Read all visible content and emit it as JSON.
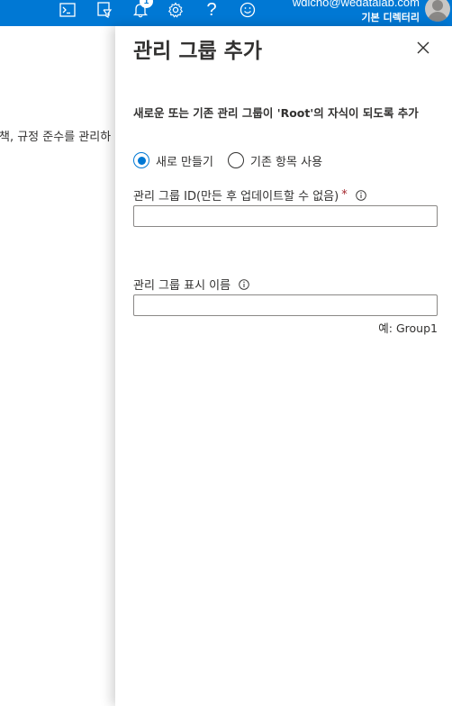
{
  "topbar": {
    "icons": [
      "cloud-shell-icon",
      "directory-filter-icon",
      "notifications-icon",
      "settings-icon",
      "help-icon",
      "feedback-icon"
    ],
    "help_glyph": "?",
    "notification_count": "1",
    "user_email": "wdlcho@wedatalab.com",
    "user_directory": "기본 디렉터리",
    "accent_color": "#0078d4"
  },
  "background": {
    "text": "책, 규정 준수를 관리하"
  },
  "panel": {
    "title": "관리 그룹 추가",
    "subtitle": "새로운 또는 기존 관리 그룹이 'Root'의 자식이 되도록 추가",
    "radio_options": [
      {
        "label": "새로 만들기",
        "checked": true
      },
      {
        "label": "기존 항목 사용",
        "checked": false
      }
    ],
    "id_field": {
      "label": "관리 그룹 ID(만든 후 업데이트할 수 없음)",
      "required_marker": "*",
      "value": ""
    },
    "display_name_field": {
      "label": "관리 그룹 표시 이름",
      "value": "",
      "hint": "예: Group1"
    }
  }
}
